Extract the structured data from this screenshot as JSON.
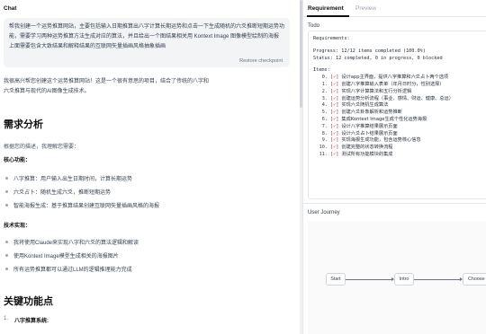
{
  "chat": {
    "title": "Chat",
    "user_message": "帮我创建一个运势推算网站，主要包括输入日期推算出八字计算长期运势和点击一下生成随机的六爻推断短期运势功能，需要学习两种运势推算方法生成对应的算法，并且给出一个图结果相关用 Kontext Image 图像模型绘制的海报上面需要包含大致结果和解释结果的互联网矢量插画风格抽象插画",
    "restore_label": "Restore checkpoint",
    "reply_intro_1": "我很高兴帮您创建这个运势推算网站！这是一个很有意思的项目，结合了传统的八字和",
    "reply_intro_2": "六爻推算与现代的AI图像生成技术。",
    "section1_title": "需求分析",
    "section1_sub": "根据您的描述，我理解您需要：",
    "core_label": "核心功能：",
    "core_items": [
      "八字推算：用户输入出生日期时间，计算长期运势",
      "六爻占卜：随机生成六爻，推断短期运势",
      "智能海报生成：基于推算结果创建互联网矢量插画风格的海报"
    ],
    "tech_label": "技术实现：",
    "tech_items": [
      "我将使用Claude来实现八字和六爻的算法逻辑和解读",
      "使用Kontext Image模型生成相关的海报图片",
      "所有运势推算都可以通过LLM的逻辑推理能力完成"
    ],
    "section2_title": "关键功能点",
    "key_items": [
      {
        "num": "1.",
        "label": "八字推算系统:"
      }
    ]
  },
  "right": {
    "tabs": [
      {
        "label": "Requirement",
        "active": true
      },
      {
        "label": "Preview",
        "active": false
      }
    ],
    "todo_label": "Todo",
    "requirements_heading": "Requirements:",
    "progress_line": "Progress: 12/12 items completed (100.0%)",
    "status_line": "Status: 12 completed, 0 in progress, 0 blocked",
    "items_heading": "Items:",
    "items": [
      {
        "num": "0.",
        "check": "[✓]",
        "text": "设计app主界面，提供八字推算和六爻占卜两个选项"
      },
      {
        "num": "1.",
        "check": "[✓]",
        "text": "创建八字推算输入表单（年月日时分，性别选择）"
      },
      {
        "num": "2.",
        "check": "[✓]",
        "text": "实现八字计算算法和五行分析逻辑"
      },
      {
        "num": "3.",
        "check": "[✓]",
        "text": "创建运势分析流程（事业、感情、财运、健康、总运）"
      },
      {
        "num": "4.",
        "check": "[✓]",
        "text": "实现六爻随机生成算法"
      },
      {
        "num": "5.",
        "check": "[✓]",
        "text": "创建六爻卦象解析和运势推断"
      },
      {
        "num": "6.",
        "check": "[✓]",
        "text": "集成Kontext Image生成个性化运势海报"
      },
      {
        "num": "7.",
        "check": "[✓]",
        "text": "设计八字推算结果展示页面"
      },
      {
        "num": "8.",
        "check": "[✓]",
        "text": "设计六爻占卜结果展示页面"
      },
      {
        "num": "9.",
        "check": "[✓]",
        "text": "实现海报生成功能，包含运势核心信息"
      },
      {
        "num": "10.",
        "check": "[✓]",
        "text": "创建完整的状态转换流程"
      },
      {
        "num": "11.",
        "check": "[✓]",
        "text": "测试所有功能模块的集成"
      }
    ],
    "journey_label": "User Journey",
    "journey_nodes": [
      "Start",
      "Intro",
      "Choose For"
    ]
  }
}
